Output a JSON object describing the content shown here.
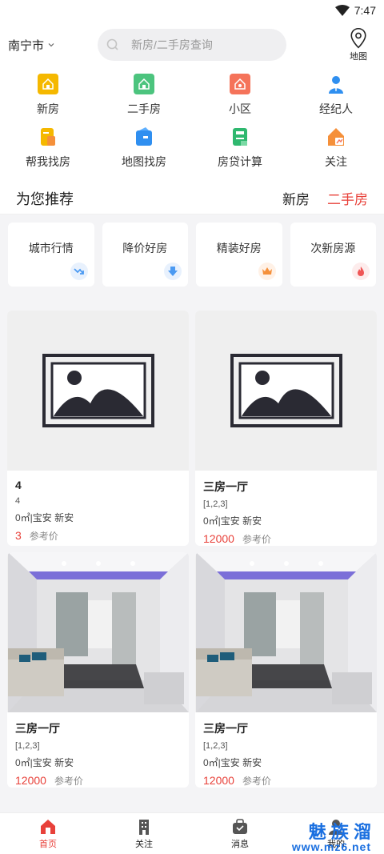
{
  "status": {
    "time": "7:47"
  },
  "header": {
    "city": "南宁市",
    "search_placeholder": "新房/二手房查询",
    "map_label": "地图"
  },
  "grid": [
    {
      "label": "新房",
      "icon": "new-house-icon",
      "color": "#f5b800"
    },
    {
      "label": "二手房",
      "icon": "second-hand-house-icon",
      "color": "#4cc47e"
    },
    {
      "label": "小区",
      "icon": "community-icon",
      "color": "#f5735a"
    },
    {
      "label": "经纪人",
      "icon": "agent-icon",
      "color": "#2f8ff0"
    },
    {
      "label": "帮我找房",
      "icon": "help-find-icon",
      "color": "#f5b800"
    },
    {
      "label": "地图找房",
      "icon": "map-find-icon",
      "color": "#2f8ff0"
    },
    {
      "label": "房贷计算",
      "icon": "mortgage-calc-icon",
      "color": "#2fb86f"
    },
    {
      "label": "关注",
      "icon": "follow-icon",
      "color": "#f5903a"
    }
  ],
  "recommend": {
    "title": "为您推荐",
    "tabs": [
      "新房",
      "二手房"
    ],
    "active_tab": "二手房"
  },
  "categories": [
    {
      "label": "城市行情",
      "badge_color": "#e8f1fd",
      "icon": "trend-down-icon"
    },
    {
      "label": "降价好房",
      "badge_color": "#e8f1fd",
      "icon": "price-drop-icon"
    },
    {
      "label": "精装好房",
      "badge_color": "#fff1e6",
      "icon": "crown-icon"
    },
    {
      "label": "次新房源",
      "badge_color": "#fdecec",
      "icon": "fire-icon"
    }
  ],
  "listings": [
    {
      "title": "4",
      "sub": "4",
      "area": "0㎡|宝安 新安",
      "price": "3",
      "price_label": "参考价",
      "image": "placeholder"
    },
    {
      "title": "三房一厅",
      "sub": "[1,2,3]",
      "area": "0㎡|宝安 新安",
      "price": "12000",
      "price_label": "参考价",
      "image": "placeholder"
    },
    {
      "title": "三房一厅",
      "sub": "[1,2,3]",
      "area": "0㎡|宝安 新安",
      "price": "12000",
      "price_label": "参考价",
      "image": "room"
    },
    {
      "title": "三房一厅",
      "sub": "[1,2,3]",
      "area": "0㎡|宝安 新安",
      "price": "12000",
      "price_label": "参考价",
      "image": "room"
    }
  ],
  "tabbar": [
    {
      "label": "首页",
      "icon": "home-icon",
      "active": true
    },
    {
      "label": "关注",
      "icon": "building-icon",
      "active": false
    },
    {
      "label": "消息",
      "icon": "message-bag-icon",
      "active": false
    },
    {
      "label": "我的",
      "icon": "profile-icon",
      "active": false
    }
  ],
  "watermark": {
    "line1": "魅 族 溜",
    "line2": "www.mz6.net"
  }
}
